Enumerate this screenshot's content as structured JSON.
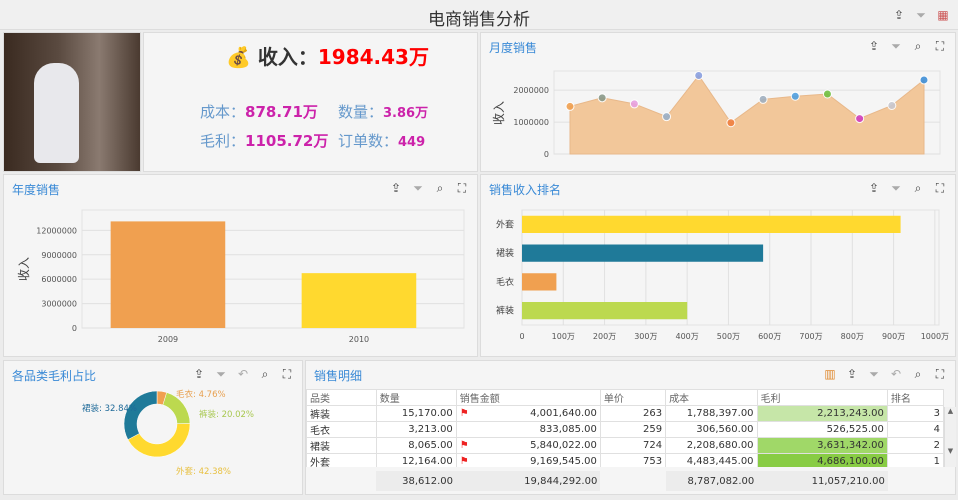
{
  "app": {
    "title": "电商销售分析"
  },
  "kpi": {
    "income_label": "收入：",
    "income": "1984.43万",
    "cost_label": "成本：",
    "cost": "878.71万",
    "qty_label": "数量：",
    "qty": "3.86万",
    "profit_label": "毛利：",
    "profit": "1105.72万",
    "orders_label": "订单数：",
    "orders": "449",
    "income_icon": "money-bag-icon"
  },
  "colors": {
    "accent": "#3a8ad6",
    "income": "#ff0000",
    "kpi_value": "#cc22aa",
    "kpi_label": "#6699cc"
  },
  "panels": {
    "monthly": "月度销售",
    "yearly": "年度销售",
    "rank": "销售收入排名",
    "pie": "各品类毛利占比",
    "table": "销售明细"
  },
  "chart_data": [
    {
      "type": "area",
      "title": "",
      "ylabel": "收入",
      "yticks": [
        "0",
        "1000000",
        "2000000"
      ],
      "ylim": [
        0,
        2600000
      ],
      "values": [
        1490000,
        1760000,
        1570000,
        1170000,
        2460000,
        980000,
        1710000,
        1810000,
        1880000,
        1110000,
        1520000,
        2320000
      ],
      "fill": "#f2c79a",
      "marker_colors": [
        "#f0a050",
        "#8a9a8a",
        "#e8a0e0",
        "#9ab0c8",
        "#8aa0e0",
        "#f08040",
        "#a0b0c0",
        "#50a0e0",
        "#70c040",
        "#d040c0",
        "#c8c8d0",
        "#4090d8"
      ]
    },
    {
      "type": "bar",
      "title": "",
      "ylabel": "收入",
      "categories": [
        "2009",
        "2010"
      ],
      "values": [
        13100000,
        6740000
      ],
      "yticks": [
        "0",
        "3000000",
        "6000000",
        "9000000",
        "12000000"
      ],
      "ylim": [
        0,
        14500000
      ],
      "colors": [
        "#f0a050",
        "#ffd92f"
      ]
    },
    {
      "type": "bar-horizontal",
      "title": "",
      "categories": [
        "外套",
        "裙装",
        "毛衣",
        "裤装"
      ],
      "values": [
        916.95,
        584.0,
        83.31,
        400.16
      ],
      "xticks": [
        "0",
        "100万",
        "200万",
        "300万",
        "400万",
        "500万",
        "600万",
        "700万",
        "800万",
        "900万",
        "1000万"
      ],
      "xlim": [
        0,
        1010
      ],
      "colors": [
        "#ffd92f",
        "#1f7a99",
        "#f0a050",
        "#bcd94f"
      ]
    },
    {
      "type": "pie",
      "title": "",
      "donut": true,
      "slices": [
        {
          "label": "毛衣: 4.76%",
          "name": "毛衣",
          "value": 4.76,
          "color": "#f0a050"
        },
        {
          "label": "裤装: 20.02%",
          "name": "裤装",
          "value": 20.02,
          "color": "#bcd94f"
        },
        {
          "label": "外套: 42.38%",
          "name": "外套",
          "value": 42.38,
          "color": "#ffd92f"
        },
        {
          "label": "裙装: 32.84%",
          "name": "裙装",
          "value": 32.84,
          "color": "#1f7a99"
        }
      ]
    }
  ],
  "table": {
    "headers": [
      "品类",
      "数量",
      "销售金额",
      "单价",
      "成本",
      "毛利",
      "排名"
    ],
    "rows": [
      [
        "裤装",
        "15,170.00",
        "4,001,640.00",
        "263",
        "1,788,397.00",
        "2,213,243.00",
        "3"
      ],
      [
        "毛衣",
        "3,213.00",
        "833,085.00",
        "259",
        "306,560.00",
        "526,525.00",
        "4"
      ],
      [
        "裙装",
        "8,065.00",
        "5,840,022.00",
        "724",
        "2,208,680.00",
        "3,631,342.00",
        "2"
      ],
      [
        "外套",
        "12,164.00",
        "9,169,545.00",
        "753",
        "4,483,445.00",
        "4,686,100.00",
        "1"
      ]
    ],
    "flags": [
      true,
      false,
      true,
      true
    ],
    "profit_colors": [
      "#c6e6a8",
      "#ffffff",
      "#a0d868",
      "#88cc44"
    ],
    "totals": [
      "",
      "38,612.00",
      "19,844,292.00",
      "",
      "8,787,082.00",
      "11,057,210.00",
      ""
    ]
  }
}
